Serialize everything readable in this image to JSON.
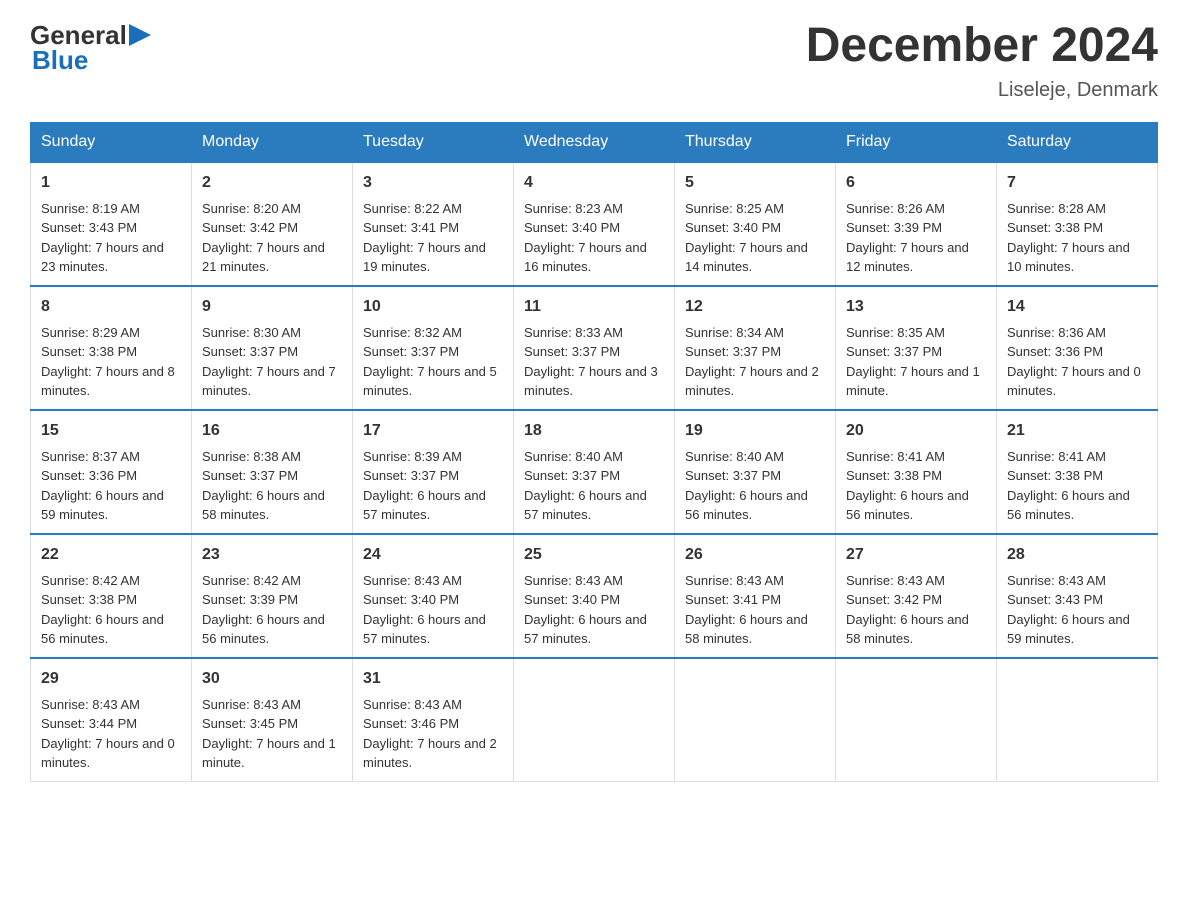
{
  "logo": {
    "text_general": "General",
    "text_blue": "Blue"
  },
  "title": "December 2024",
  "subtitle": "Liseleje, Denmark",
  "days_of_week": [
    "Sunday",
    "Monday",
    "Tuesday",
    "Wednesday",
    "Thursday",
    "Friday",
    "Saturday"
  ],
  "weeks": [
    [
      {
        "num": "1",
        "sunrise": "8:19 AM",
        "sunset": "3:43 PM",
        "daylight": "7 hours and 23 minutes."
      },
      {
        "num": "2",
        "sunrise": "8:20 AM",
        "sunset": "3:42 PM",
        "daylight": "7 hours and 21 minutes."
      },
      {
        "num": "3",
        "sunrise": "8:22 AM",
        "sunset": "3:41 PM",
        "daylight": "7 hours and 19 minutes."
      },
      {
        "num": "4",
        "sunrise": "8:23 AM",
        "sunset": "3:40 PM",
        "daylight": "7 hours and 16 minutes."
      },
      {
        "num": "5",
        "sunrise": "8:25 AM",
        "sunset": "3:40 PM",
        "daylight": "7 hours and 14 minutes."
      },
      {
        "num": "6",
        "sunrise": "8:26 AM",
        "sunset": "3:39 PM",
        "daylight": "7 hours and 12 minutes."
      },
      {
        "num": "7",
        "sunrise": "8:28 AM",
        "sunset": "3:38 PM",
        "daylight": "7 hours and 10 minutes."
      }
    ],
    [
      {
        "num": "8",
        "sunrise": "8:29 AM",
        "sunset": "3:38 PM",
        "daylight": "7 hours and 8 minutes."
      },
      {
        "num": "9",
        "sunrise": "8:30 AM",
        "sunset": "3:37 PM",
        "daylight": "7 hours and 7 minutes."
      },
      {
        "num": "10",
        "sunrise": "8:32 AM",
        "sunset": "3:37 PM",
        "daylight": "7 hours and 5 minutes."
      },
      {
        "num": "11",
        "sunrise": "8:33 AM",
        "sunset": "3:37 PM",
        "daylight": "7 hours and 3 minutes."
      },
      {
        "num": "12",
        "sunrise": "8:34 AM",
        "sunset": "3:37 PM",
        "daylight": "7 hours and 2 minutes."
      },
      {
        "num": "13",
        "sunrise": "8:35 AM",
        "sunset": "3:37 PM",
        "daylight": "7 hours and 1 minute."
      },
      {
        "num": "14",
        "sunrise": "8:36 AM",
        "sunset": "3:36 PM",
        "daylight": "7 hours and 0 minutes."
      }
    ],
    [
      {
        "num": "15",
        "sunrise": "8:37 AM",
        "sunset": "3:36 PM",
        "daylight": "6 hours and 59 minutes."
      },
      {
        "num": "16",
        "sunrise": "8:38 AM",
        "sunset": "3:37 PM",
        "daylight": "6 hours and 58 minutes."
      },
      {
        "num": "17",
        "sunrise": "8:39 AM",
        "sunset": "3:37 PM",
        "daylight": "6 hours and 57 minutes."
      },
      {
        "num": "18",
        "sunrise": "8:40 AM",
        "sunset": "3:37 PM",
        "daylight": "6 hours and 57 minutes."
      },
      {
        "num": "19",
        "sunrise": "8:40 AM",
        "sunset": "3:37 PM",
        "daylight": "6 hours and 56 minutes."
      },
      {
        "num": "20",
        "sunrise": "8:41 AM",
        "sunset": "3:38 PM",
        "daylight": "6 hours and 56 minutes."
      },
      {
        "num": "21",
        "sunrise": "8:41 AM",
        "sunset": "3:38 PM",
        "daylight": "6 hours and 56 minutes."
      }
    ],
    [
      {
        "num": "22",
        "sunrise": "8:42 AM",
        "sunset": "3:38 PM",
        "daylight": "6 hours and 56 minutes."
      },
      {
        "num": "23",
        "sunrise": "8:42 AM",
        "sunset": "3:39 PM",
        "daylight": "6 hours and 56 minutes."
      },
      {
        "num": "24",
        "sunrise": "8:43 AM",
        "sunset": "3:40 PM",
        "daylight": "6 hours and 57 minutes."
      },
      {
        "num": "25",
        "sunrise": "8:43 AM",
        "sunset": "3:40 PM",
        "daylight": "6 hours and 57 minutes."
      },
      {
        "num": "26",
        "sunrise": "8:43 AM",
        "sunset": "3:41 PM",
        "daylight": "6 hours and 58 minutes."
      },
      {
        "num": "27",
        "sunrise": "8:43 AM",
        "sunset": "3:42 PM",
        "daylight": "6 hours and 58 minutes."
      },
      {
        "num": "28",
        "sunrise": "8:43 AM",
        "sunset": "3:43 PM",
        "daylight": "6 hours and 59 minutes."
      }
    ],
    [
      {
        "num": "29",
        "sunrise": "8:43 AM",
        "sunset": "3:44 PM",
        "daylight": "7 hours and 0 minutes."
      },
      {
        "num": "30",
        "sunrise": "8:43 AM",
        "sunset": "3:45 PM",
        "daylight": "7 hours and 1 minute."
      },
      {
        "num": "31",
        "sunrise": "8:43 AM",
        "sunset": "3:46 PM",
        "daylight": "7 hours and 2 minutes."
      },
      null,
      null,
      null,
      null
    ]
  ]
}
